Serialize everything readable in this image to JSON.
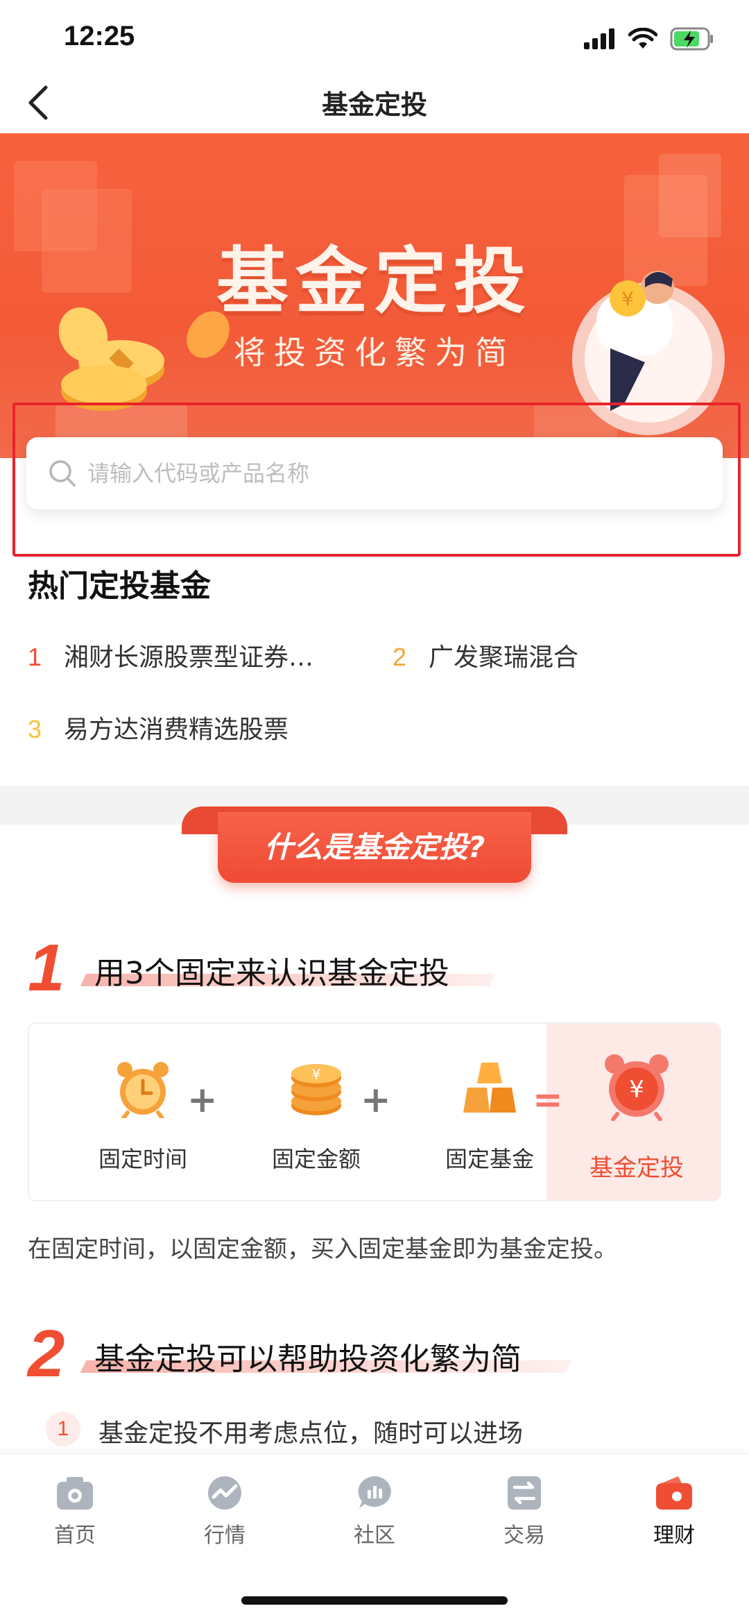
{
  "status_bar": {
    "time": "12:25"
  },
  "nav": {
    "title": "基金定投"
  },
  "banner": {
    "title": "基金定投",
    "subtitle": "将投资化繁为简"
  },
  "search": {
    "placeholder": "请输入代码或产品名称",
    "value": ""
  },
  "hot": {
    "title": "热门定投基金",
    "items": [
      {
        "rank": "1",
        "name": "湘财长源股票型证券…",
        "rank_color": "#f04e32"
      },
      {
        "rank": "2",
        "name": "广发聚瑞混合",
        "rank_color": "#f5a23a"
      },
      {
        "rank": "3",
        "name": "易方达消费精选股票",
        "rank_color": "#f5c33a"
      }
    ]
  },
  "explain": {
    "tab_label": "什么是基金定投?",
    "section1": {
      "num": "1",
      "title": "用3个固定来认识基金定投",
      "formula": [
        {
          "label": "固定时间",
          "icon": "alarm-clock-icon"
        },
        {
          "label": "固定金额",
          "icon": "coin-stack-icon"
        },
        {
          "label": "固定基金",
          "icon": "gold-bars-icon"
        }
      ],
      "op_plus": "+",
      "op_equals": "=",
      "result_label": "基金定投",
      "result_icon": "yuan-alarm-clock-icon",
      "description": "在固定时间，以固定金额，买入固定基金即为基金定投。"
    },
    "section2": {
      "num": "2",
      "title": "基金定投可以帮助投资化繁为简",
      "points": [
        {
          "num": "1",
          "text": "基金定投不用考虑点位，随时可以进场"
        }
      ]
    }
  },
  "tab_bar": {
    "items": [
      {
        "label": "首页",
        "icon": "home-camera-icon"
      },
      {
        "label": "行情",
        "icon": "market-trend-icon"
      },
      {
        "label": "社区",
        "icon": "community-chat-icon"
      },
      {
        "label": "交易",
        "icon": "trade-exchange-icon"
      },
      {
        "label": "理财",
        "icon": "wealth-wallet-icon",
        "active": true
      }
    ]
  },
  "colors": {
    "accent": "#f04e32",
    "banner": "#f35a37",
    "highlight": "#e8242a"
  }
}
